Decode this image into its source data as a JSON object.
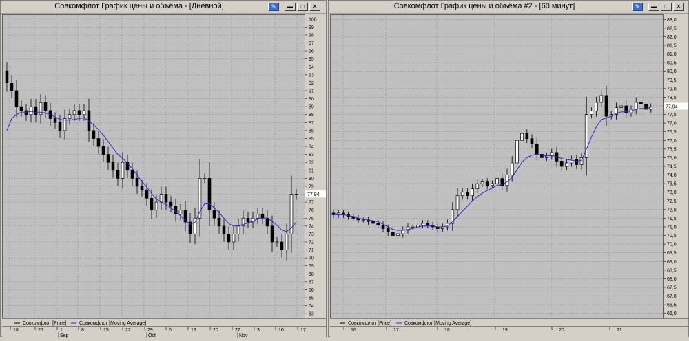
{
  "colors": {
    "plot_bg": "#c0c0c0",
    "grid": "#8a8a8a",
    "candle": "#000000",
    "ma": "#2828d0",
    "axis_bg": "#d4d0c8"
  },
  "left": {
    "title": "Совкомфлот График цены и объёма - [Дневной]",
    "legend": {
      "price": "Совкомфлот [Price]",
      "ma": "Совкомфлот [Moving Average]"
    },
    "last_price": "77,94",
    "y_ticks": [
      "100",
      "99",
      "98",
      "97",
      "96",
      "95",
      "94",
      "93",
      "92",
      "91",
      "90",
      "89",
      "88",
      "87",
      "86",
      "85",
      "84",
      "83",
      "82",
      "81",
      "80",
      "79",
      "78",
      "77",
      "76",
      "75",
      "74",
      "73",
      "72",
      "71",
      "70",
      "69",
      "68",
      "67",
      "66",
      "65",
      "64",
      "63"
    ],
    "x_days": [
      "18",
      "25",
      "1",
      "8",
      "15",
      "22",
      "29",
      "6",
      "13",
      "20",
      "27",
      "3",
      "10",
      "17"
    ],
    "x_months": [
      "Sep",
      "Oct",
      "Nov"
    ]
  },
  "right": {
    "title": "Совкомфлот График цены и объёма #2 - [60 минут]",
    "legend": {
      "price": "Совкомфлот [Price]",
      "ma": "Совкомфлот [Moving Average]"
    },
    "last_price": "77,94",
    "y_ticks": [
      "83,0",
      "82,5",
      "82,0",
      "81,5",
      "81,0",
      "80,5",
      "80,0",
      "79,5",
      "79,0",
      "78,5",
      "78,0",
      "77,5",
      "77,0",
      "76,5",
      "76,0",
      "75,5",
      "75,0",
      "74,5",
      "74,0",
      "73,5",
      "73,0",
      "72,5",
      "72,0",
      "71,5",
      "71,0",
      "70,5",
      "70,0",
      "69,5",
      "69,0",
      "68,5",
      "68,0",
      "67,5",
      "67,0",
      "66,5",
      "66,0"
    ],
    "x_days": [
      "16",
      "17",
      "18",
      "19",
      "20",
      "21"
    ]
  },
  "chart_data": [
    {
      "type": "candlestick",
      "title": "Совкомфлот График цены и объёма - [Дневной]",
      "ylim": [
        62.5,
        100.5
      ],
      "series": [
        {
          "name": "Совкомфлот [Price]",
          "close": [
            92,
            91,
            89,
            88.5,
            88,
            89,
            88,
            89.5,
            88.5,
            87.5,
            87,
            86,
            87.5,
            88,
            88.5,
            88,
            88.5,
            86,
            85,
            84,
            83,
            82,
            81,
            80,
            82,
            81,
            80,
            79,
            78.5,
            77.5,
            76,
            77,
            78,
            77,
            76.5,
            75.5,
            76,
            74.5,
            73,
            75,
            80,
            80,
            76,
            75,
            74,
            73,
            72,
            73,
            74,
            75,
            74.5,
            75,
            75.5,
            75,
            74,
            72,
            72,
            71,
            73,
            78,
            77.94
          ]
        },
        {
          "name": "Совкомфлот [Moving Average]",
          "values": [
            86,
            87.5,
            88,
            88.3,
            88.3,
            88.4,
            88.3,
            88.3,
            88.2,
            88,
            87.7,
            87.4,
            87.3,
            87.3,
            87.4,
            87.5,
            87.6,
            87.2,
            86.7,
            86.1,
            85.4,
            84.6,
            83.8,
            83,
            82.5,
            81.9,
            81.2,
            80.4,
            79.6,
            78.9,
            78.1,
            77.4,
            77,
            76.7,
            76.3,
            75.8,
            75.3,
            74.7,
            74.2,
            74.5,
            75.8,
            76.8,
            76.8,
            76.3,
            75.7,
            75,
            74.3,
            74,
            74,
            74.2,
            74.4,
            74.6,
            74.9,
            75,
            75,
            74.6,
            74.1,
            73.5,
            73.3,
            73.8,
            74.5
          ]
        }
      ]
    },
    {
      "type": "candlestick",
      "title": "Совкомфлот График цены и объёма #2 - [60 минут]",
      "ylim": [
        65.75,
        83.25
      ],
      "series": [
        {
          "name": "Совкомфлот [Price]",
          "close": [
            71.7,
            71.8,
            71.7,
            71.6,
            71.5,
            71.4,
            71.4,
            71.3,
            71.2,
            71.1,
            70.9,
            70.7,
            70.5,
            70.6,
            70.8,
            71,
            71,
            71.1,
            71.2,
            71.1,
            71,
            70.9,
            71,
            71.2,
            72,
            72.8,
            73,
            72.8,
            73.2,
            73.5,
            73.6,
            73.4,
            73.5,
            73.8,
            73.4,
            74,
            74.7,
            76,
            76.4,
            76.1,
            75.8,
            75.2,
            75,
            75.1,
            75.3,
            74.8,
            74.5,
            74.7,
            74.9,
            74.6,
            75,
            77.5,
            77.7,
            78.2,
            78.6,
            77.4,
            77.5,
            77.9,
            78,
            77.6,
            77.8,
            78.2,
            78.1,
            77.8,
            77.94
          ]
        },
        {
          "name": "Совкомфлот [Moving Average]",
          "values": [
            71.7,
            71.7,
            71.7,
            71.65,
            71.6,
            71.5,
            71.45,
            71.4,
            71.35,
            71.3,
            71.15,
            71,
            70.85,
            70.8,
            70.8,
            70.85,
            70.9,
            71,
            71.05,
            71.05,
            71.05,
            71,
            71,
            71.05,
            71.3,
            71.6,
            71.9,
            72.2,
            72.5,
            72.75,
            72.95,
            73.1,
            73.25,
            73.4,
            73.45,
            73.6,
            73.85,
            74.3,
            74.75,
            75,
            75.15,
            75.2,
            75.15,
            75.1,
            75.15,
            75.05,
            74.95,
            74.9,
            74.85,
            74.8,
            74.85,
            75.5,
            76.2,
            76.8,
            77.2,
            77.3,
            77.4,
            77.55,
            77.65,
            77.65,
            77.7,
            77.8,
            77.85,
            77.85,
            77.9
          ]
        }
      ]
    }
  ]
}
